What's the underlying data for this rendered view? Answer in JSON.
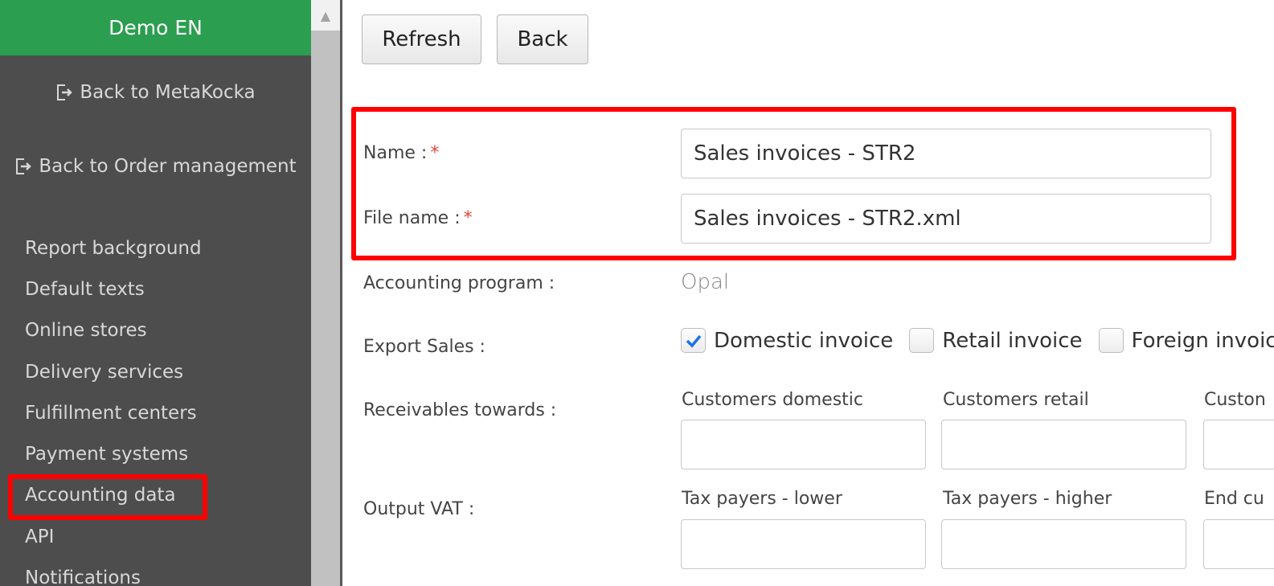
{
  "sidebar": {
    "header": "Demo EN",
    "back_metakocka": "Back to MetaKocka",
    "back_order": "Back to Order management",
    "items": [
      {
        "label": "Report background"
      },
      {
        "label": "Default texts"
      },
      {
        "label": "Online stores"
      },
      {
        "label": "Delivery services"
      },
      {
        "label": "Fulfillment centers"
      },
      {
        "label": "Payment systems"
      },
      {
        "label": "Accounting data"
      },
      {
        "label": "API"
      },
      {
        "label": "Notifications"
      }
    ]
  },
  "toolbar": {
    "refresh_label": "Refresh",
    "back_label": "Back"
  },
  "form": {
    "name_label": "Name :",
    "name_value": "Sales invoices - STR2",
    "file_name_label": "File name :",
    "file_name_value": "Sales invoices - STR2.xml",
    "required_mark": "*",
    "accounting_program_label": "Accounting program :",
    "accounting_program_value": "Opal",
    "export_sales_label": "Export Sales :",
    "export_options": [
      {
        "label": "Domestic invoice",
        "checked": true
      },
      {
        "label": "Retail invoice",
        "checked": false
      },
      {
        "label": "Foreign invoice",
        "checked": false
      }
    ],
    "receivables_label": "Receivables towards :",
    "receivables_cols": [
      "Customers domestic",
      "Customers retail",
      "Custon"
    ],
    "output_vat_label": "Output VAT :",
    "output_vat_cols": [
      "Tax payers - lower",
      "Tax payers - higher",
      "End cu"
    ]
  },
  "colors": {
    "sidebar_header": "#2b9e4f",
    "sidebar_bg": "#4d4d4d",
    "highlight": "#ff0000",
    "check": "#1a73e8"
  }
}
